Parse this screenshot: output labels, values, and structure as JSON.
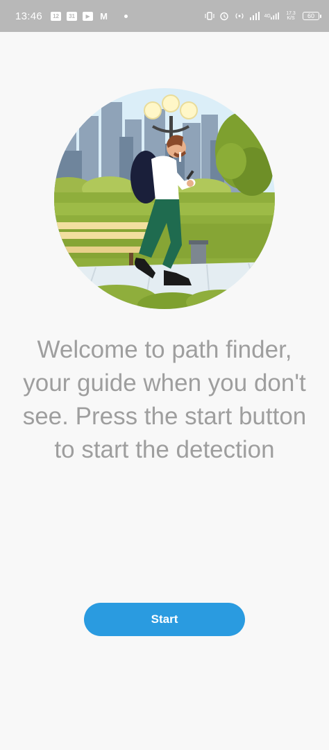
{
  "status_bar": {
    "time": "13:46",
    "notifications": [
      {
        "icon": "calendar-icon",
        "label": "12"
      },
      {
        "icon": "calendar-icon",
        "label": "31"
      },
      {
        "icon": "youtube-icon",
        "label": "▶"
      },
      {
        "icon": "gmail-icon",
        "label": "M"
      }
    ],
    "network_speed": "17.3 K/S",
    "network_type": "4G",
    "battery": "60"
  },
  "main": {
    "welcome_text": "Welcome to path finder, your guide when you don't see. Press the start button to start the detection",
    "start_label": "Start"
  },
  "colors": {
    "status_bar_bg": "#b8b8b8",
    "page_bg": "#f8f8f8",
    "text_gray": "#9e9e9e",
    "accent": "#2a9be0"
  }
}
